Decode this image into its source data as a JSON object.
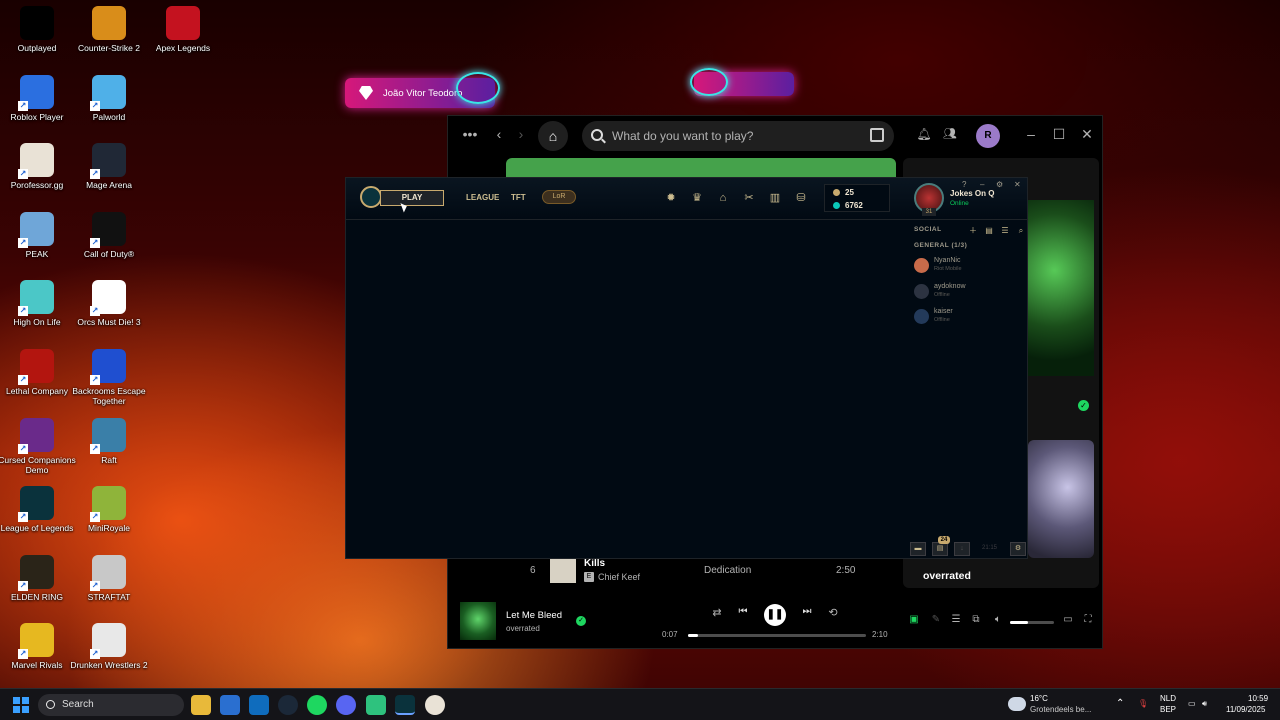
{
  "desktop_icons": [
    {
      "label": "Outplayed",
      "icon": "outplayed-icon",
      "color": "#000000"
    },
    {
      "label": "Counter-Strike 2",
      "icon": "counter-strike-icon",
      "color": "#d98d1a"
    },
    {
      "label": "Apex Legends",
      "icon": "apex-legends-icon",
      "color": "#c4121f"
    },
    {
      "label": "Roblox Player",
      "icon": "roblox-icon",
      "color": "#2b6fe0"
    },
    {
      "label": "Palworld",
      "icon": "palworld-icon",
      "color": "#4fb0e8"
    },
    {
      "label": "Porofessor.gg",
      "icon": "porofessor-icon",
      "color": "#e9e2d6"
    },
    {
      "label": "Mage Arena",
      "icon": "mage-arena-icon",
      "color": "#202836"
    },
    {
      "label": "PEAK",
      "icon": "peak-icon",
      "color": "#6fa6d8"
    },
    {
      "label": "Call of Duty®",
      "icon": "call-of-duty-icon",
      "color": "#111111"
    },
    {
      "label": "High On Life",
      "icon": "high-on-life-icon",
      "color": "#4bc7c7"
    },
    {
      "label": "Orcs Must Die! 3",
      "icon": "orcs-must-die-icon",
      "color": "#ffffff"
    },
    {
      "label": "Lethal Company",
      "icon": "lethal-company-icon",
      "color": "#b3150f"
    },
    {
      "label": "Backrooms Escape Together",
      "icon": "backrooms-icon",
      "color": "#1f4fd0"
    },
    {
      "label": "Cursed Companions Demo",
      "icon": "cursed-companions-icon",
      "color": "#6a2a8a"
    },
    {
      "label": "Raft",
      "icon": "raft-icon",
      "color": "#3a7fa8"
    },
    {
      "label": "League of Legends",
      "icon": "league-icon",
      "color": "#0a323c"
    },
    {
      "label": "MiniRoyale",
      "icon": "miniroyale-icon",
      "color": "#8fb43a"
    },
    {
      "label": "ELDEN RING",
      "icon": "elden-ring-icon",
      "color": "#2a2418"
    },
    {
      "label": "STRAFTAT",
      "icon": "straftat-icon",
      "color": "#c8c8c8"
    },
    {
      "label": "Marvel Rivals",
      "icon": "marvel-rivals-icon",
      "color": "#e6b820"
    },
    {
      "label": "Drunken Wrestlers 2",
      "icon": "drunken-wrestlers-icon",
      "color": "#e8e8e8"
    }
  ],
  "overlay": {
    "username": "João Vitor Teodoro"
  },
  "spotify": {
    "search_placeholder": "What do you want to play?",
    "avatar_letter": "R",
    "right_panel_title": "overrated",
    "track_row": {
      "number": "6",
      "title": "Kills",
      "artist": "Chief Keef",
      "explicit": "E",
      "album": "Dedication",
      "duration": "2:50"
    },
    "player": {
      "song": "Let Me Bleed",
      "artist": "overrated",
      "elapsed": "0:07",
      "total": "2:10",
      "progress": 0.054,
      "volume": 0.4
    }
  },
  "league": {
    "play_label": "PLAY",
    "nav_league": "LEAGUE",
    "nav_tft": "TFT",
    "nav_lor": "LoR",
    "currency_rp": "25",
    "currency_be": "6762",
    "summoner_name": "Jokes On Q",
    "status": "Online",
    "level": "31",
    "social_header": "SOCIAL",
    "group_label": "GENERAL (1/3)",
    "friends": [
      {
        "name": "NyanNic",
        "status": "Riot Mobile"
      },
      {
        "name": "aydoknow",
        "status": "Offline"
      },
      {
        "name": "kaiser",
        "status": "Offline"
      }
    ],
    "badge_count": "24",
    "clock": "21:15"
  },
  "taskbar": {
    "search_label": "Search",
    "weather_temp": "16°C",
    "weather_desc": "Grotendeels be...",
    "lang": "NLD",
    "lang_sub": "BEP",
    "time": "10:59",
    "date": "11/09/2025"
  }
}
